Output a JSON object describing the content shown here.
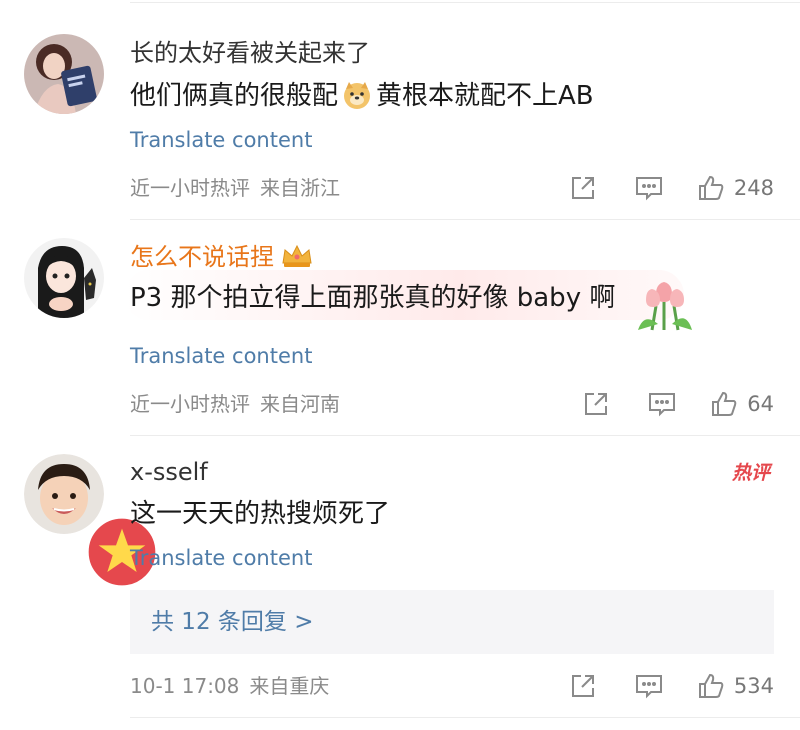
{
  "comments": [
    {
      "username": "长的太好看被关起来了",
      "text_before": "他们俩真的很般配",
      "emoji": "doge-icon",
      "text_after": "黄根本就配不上AB",
      "translate": "Translate content",
      "time": "近一小时热评",
      "location": "来自浙江",
      "likes": "248"
    },
    {
      "username": "怎么不说话捏",
      "badge": "crown-icon",
      "text": "P3 那个拍立得上面那张真的好像 baby 啊",
      "translate": "Translate content",
      "time": "近一小时热评",
      "location": "来自河南",
      "likes": "64"
    },
    {
      "username": "x-sself",
      "hot_label": "热评",
      "text": "这一天天的热搜烦死了",
      "translate": "Translate content",
      "replies": "共 12 条回复 >",
      "time": "10-1 17:08",
      "location": "来自重庆",
      "likes": "534"
    }
  ],
  "colors": {
    "link": "#4f7ca8",
    "username_vip": "#e8761a",
    "hot": "#e5484d",
    "meta": "#8a8a8a"
  }
}
